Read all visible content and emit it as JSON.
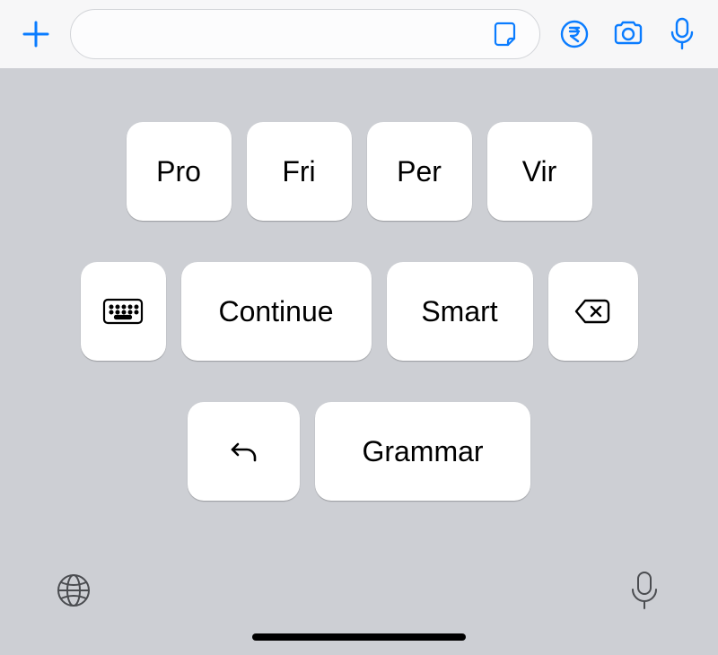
{
  "toolbar": {
    "input_placeholder": ""
  },
  "keyboard": {
    "row1": [
      "Pro",
      "Fri",
      "Per",
      "Vir"
    ],
    "row2": {
      "continue": "Continue",
      "smart": "Smart"
    },
    "row3": {
      "grammar": "Grammar"
    }
  },
  "icons": {
    "plus": "plus-icon",
    "sticker": "sticker-icon",
    "rupee": "rupee-icon",
    "camera": "camera-icon",
    "mic": "mic-icon",
    "keyboard": "keyboard-icon",
    "backspace": "backspace-icon",
    "undo": "undo-icon",
    "globe": "globe-icon",
    "dictate": "dictate-icon"
  }
}
